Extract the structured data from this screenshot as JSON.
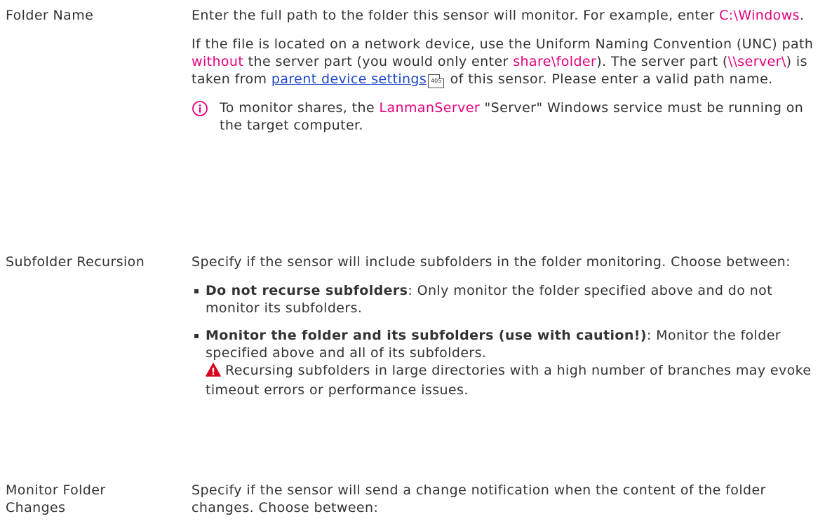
{
  "rows": {
    "folder_name": {
      "label": "Folder Name",
      "p1_pre": "Enter the full path to the folder this sensor will monitor. For example, enter ",
      "p1_hl": "C:\\Windows",
      "p1_post": ".",
      "p2_a": "If the file is located on a network device, use the Uniform Naming Convention (UNC) path ",
      "p2_hl1": "without",
      "p2_b": " the server part (you would only enter ",
      "p2_hl2": "share\\folder",
      "p2_c": "). The server part (",
      "p2_hl3": "\\\\server\\",
      "p2_d": ") is taken from ",
      "p2_link": "parent device settings",
      "p2_pageref": "405",
      "p2_e": " of this sensor. Please enter a valid path name.",
      "note_a": "To monitor shares, the ",
      "note_hl": "LanmanServer",
      "note_b": " \"Server\" Windows service must be running on the target computer."
    },
    "subfolder_recursion": {
      "label": "Subfolder Recursion",
      "intro": "Specify if the sensor will include subfolders in the folder monitoring. Choose between:",
      "opt1_bold": "Do not recurse subfolders",
      "opt1_text": ": Only monitor the folder specified above and do not monitor its subfolders.",
      "opt2_bold": "Monitor the folder and its subfolders (use with caution!)",
      "opt2_text": ": Monitor the folder specified above and all of its subfolders.",
      "warning": "Recursing subfolders in large directories with a high number of branches may evoke timeout errors or performance issues."
    },
    "monitor_folder_changes": {
      "label": "Monitor Folder Changes",
      "intro": "Specify if the sensor will send a change notification when the content of the folder changes. Choose between:"
    }
  },
  "icons": {
    "info": "info-icon",
    "warning": "warning-icon"
  },
  "colors": {
    "highlight": "#e6007e",
    "link": "#1f49c7",
    "info_icon": "#e6007e",
    "warning_icon": "#d8001d"
  }
}
